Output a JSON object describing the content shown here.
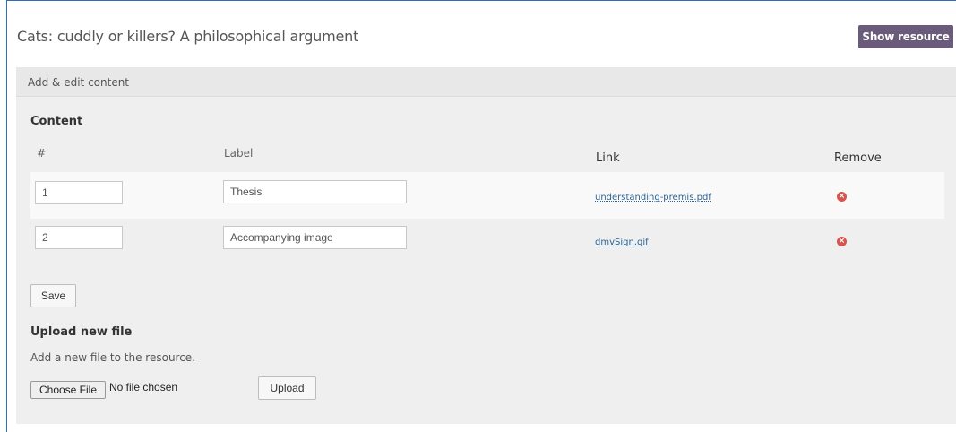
{
  "page_title": "Cats: cuddly or killers? A philosophical argument",
  "show_resource_label": "Show resource",
  "panel": {
    "header": "Add & edit content",
    "content_title": "Content",
    "columns": {
      "number": "#",
      "label": "Label",
      "link": "Link",
      "remove": "Remove"
    },
    "rows": [
      {
        "number": "1",
        "label": "Thesis",
        "link": "understanding-premis.pdf",
        "remove_icon": "remove-icon"
      },
      {
        "number": "2",
        "label": "Accompanying image",
        "link": "dmvSign.gif",
        "remove_icon": "remove-icon"
      }
    ],
    "save_label": "Save",
    "upload": {
      "title": "Upload new file",
      "description": "Add a new file to the resource.",
      "choose_label": "Choose File",
      "no_file_text": "No file chosen",
      "upload_label": "Upload"
    }
  },
  "colors": {
    "frame_border": "#2f6fb5",
    "show_button": "#6b5b7b",
    "remove_icon": "#d9534f",
    "link": "#2a6496"
  }
}
